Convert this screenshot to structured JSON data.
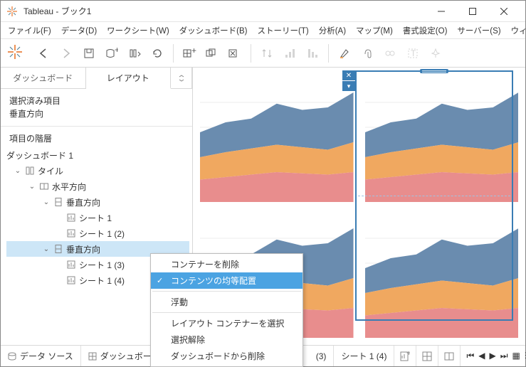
{
  "window": {
    "title": "Tableau - ブック1"
  },
  "menu": {
    "items": [
      "ファイル(F)",
      "データ(D)",
      "ワークシート(W)",
      "ダッシュボード(B)",
      "ストーリー(T)",
      "分析(A)",
      "マップ(M)",
      "書式設定(O)",
      "サーバー(S)",
      "ウィンドウ(N)"
    ]
  },
  "sidebar": {
    "tabs": {
      "dashboard": "ダッシュボード",
      "layout": "レイアウト"
    },
    "selected_items": {
      "l1": "選択済み項目",
      "l2": "垂直方向"
    },
    "hierarchy_title": "項目の階層",
    "tree": {
      "root": "ダッシュボード 1",
      "tile": "タイル",
      "horizontal": "水平方向",
      "vertical1": "垂直方向",
      "sheet1": "シート 1",
      "sheet1_2": "シート 1 (2)",
      "vertical2": "垂直方向",
      "sheet1_3": "シート 1 (3)",
      "sheet1_4": "シート 1 (4)"
    }
  },
  "context": {
    "delete_container": "コンテナーを削除",
    "distribute": "コンテンツの均等配置",
    "floating": "浮動",
    "select_container": "レイアウト コンテナーを選択",
    "deselect": "選択解除",
    "remove_from_dashboard": "ダッシュボードから削除"
  },
  "bottom": {
    "data_source": "データ ソース",
    "dashboard": "ダッシュボー",
    "sheet3": "(3)",
    "sheet4": "シート 1 (4)"
  },
  "chart_data": {
    "type": "area",
    "note": "Four repeated stacked-area thumbnails; values are approximate visual estimates on a 0–100 scale across 7 x-positions.",
    "x": [
      0,
      1,
      2,
      3,
      4,
      5,
      6
    ],
    "series": [
      {
        "name": "red",
        "values": [
          18,
          20,
          22,
          24,
          23,
          22,
          24
        ]
      },
      {
        "name": "orange",
        "values": [
          18,
          20,
          21,
          22,
          21,
          20,
          24
        ]
      },
      {
        "name": "blue",
        "values": [
          20,
          24,
          24,
          33,
          30,
          34,
          40
        ]
      }
    ],
    "ylim": [
      0,
      100
    ]
  }
}
